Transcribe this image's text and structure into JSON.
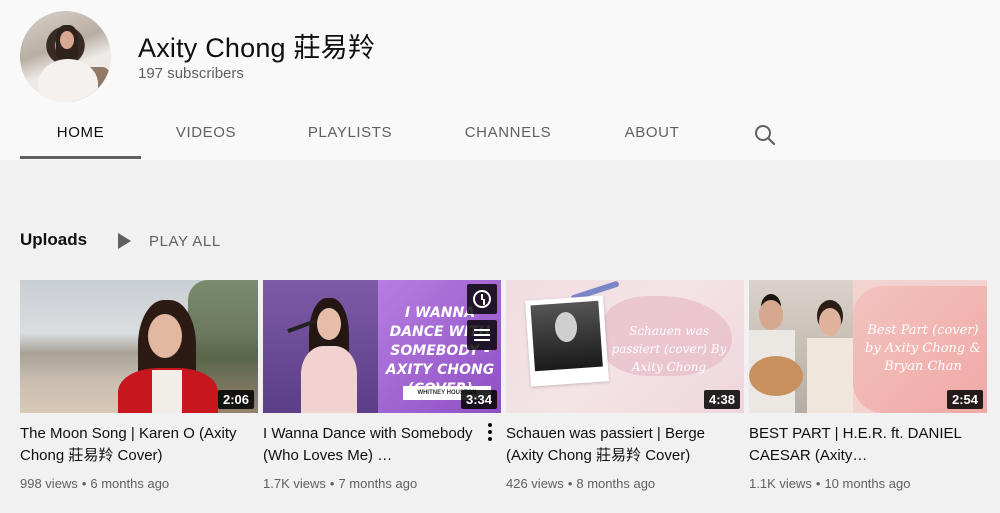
{
  "channel": {
    "name": "Axity Chong 莊易羚",
    "subscribers": "197 subscribers"
  },
  "tabs": [
    {
      "label": "HOME",
      "active": true
    },
    {
      "label": "VIDEOS",
      "active": false
    },
    {
      "label": "PLAYLISTS",
      "active": false
    },
    {
      "label": "CHANNELS",
      "active": false
    },
    {
      "label": "ABOUT",
      "active": false
    }
  ],
  "shelf": {
    "title": "Uploads",
    "play_all_label": "PLAY ALL"
  },
  "videos": [
    {
      "title": "The Moon Song | Karen O (Axity Chong 莊易羚 Cover)",
      "duration": "2:06",
      "views": "998 views",
      "age": "6 months ago"
    },
    {
      "title": "I Wanna Dance with Somebody (Who Loves Me) …",
      "duration": "3:34",
      "views": "1.7K views",
      "age": "7 months ago",
      "thumb_text": "I WANNA DANCE WITH SOMEBODY - AXITY CHONG (COVER)",
      "thumb_small": "WHITNEY HOUSTON"
    },
    {
      "title": "Schauen was passiert | Berge (Axity Chong 莊易羚 Cover)",
      "duration": "4:38",
      "views": "426 views",
      "age": "8 months ago",
      "thumb_text": "Schauen was passiert (cover) By Axity Chong"
    },
    {
      "title": "BEST PART | H.E.R. ft. DANIEL CAESAR (Axity…",
      "duration": "2:54",
      "views": "1.1K views",
      "age": "10 months ago",
      "thumb_text": "Best Part (cover) by Axity Chong & Bryan Chan"
    }
  ],
  "colors": {
    "header_bg": "#f9f9f9",
    "content_bg": "#f1f1f1",
    "text_primary": "#0f0f0f",
    "text_secondary": "#606060"
  }
}
